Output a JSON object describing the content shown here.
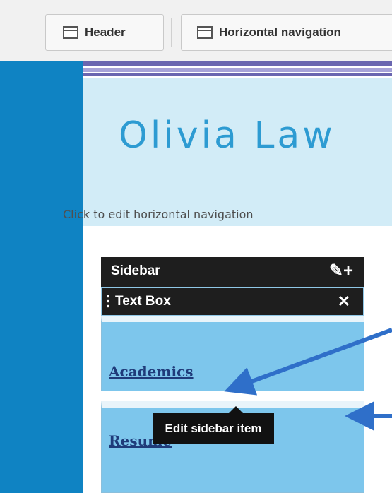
{
  "toolbar": {
    "header_label": "Header",
    "hnav_label": "Horizontal navigation"
  },
  "site": {
    "title": "Olivia Law",
    "hnav_hint": "Click to edit horizontal navigation"
  },
  "sidebar": {
    "title": "Sidebar",
    "tools": "✎+",
    "textbox_title": "Text Box",
    "close_glyph": "✕",
    "items": [
      {
        "label": "Academics"
      },
      {
        "label": "Resume"
      }
    ]
  },
  "tooltip": {
    "text": "Edit sidebar item"
  },
  "colors": {
    "left_strip": "#0f83c3",
    "header_bg": "#d2ecf7",
    "title_color": "#2d9bd2",
    "sidebar_item_bg": "#7dc6ec",
    "arrow": "#2f6fc9"
  }
}
